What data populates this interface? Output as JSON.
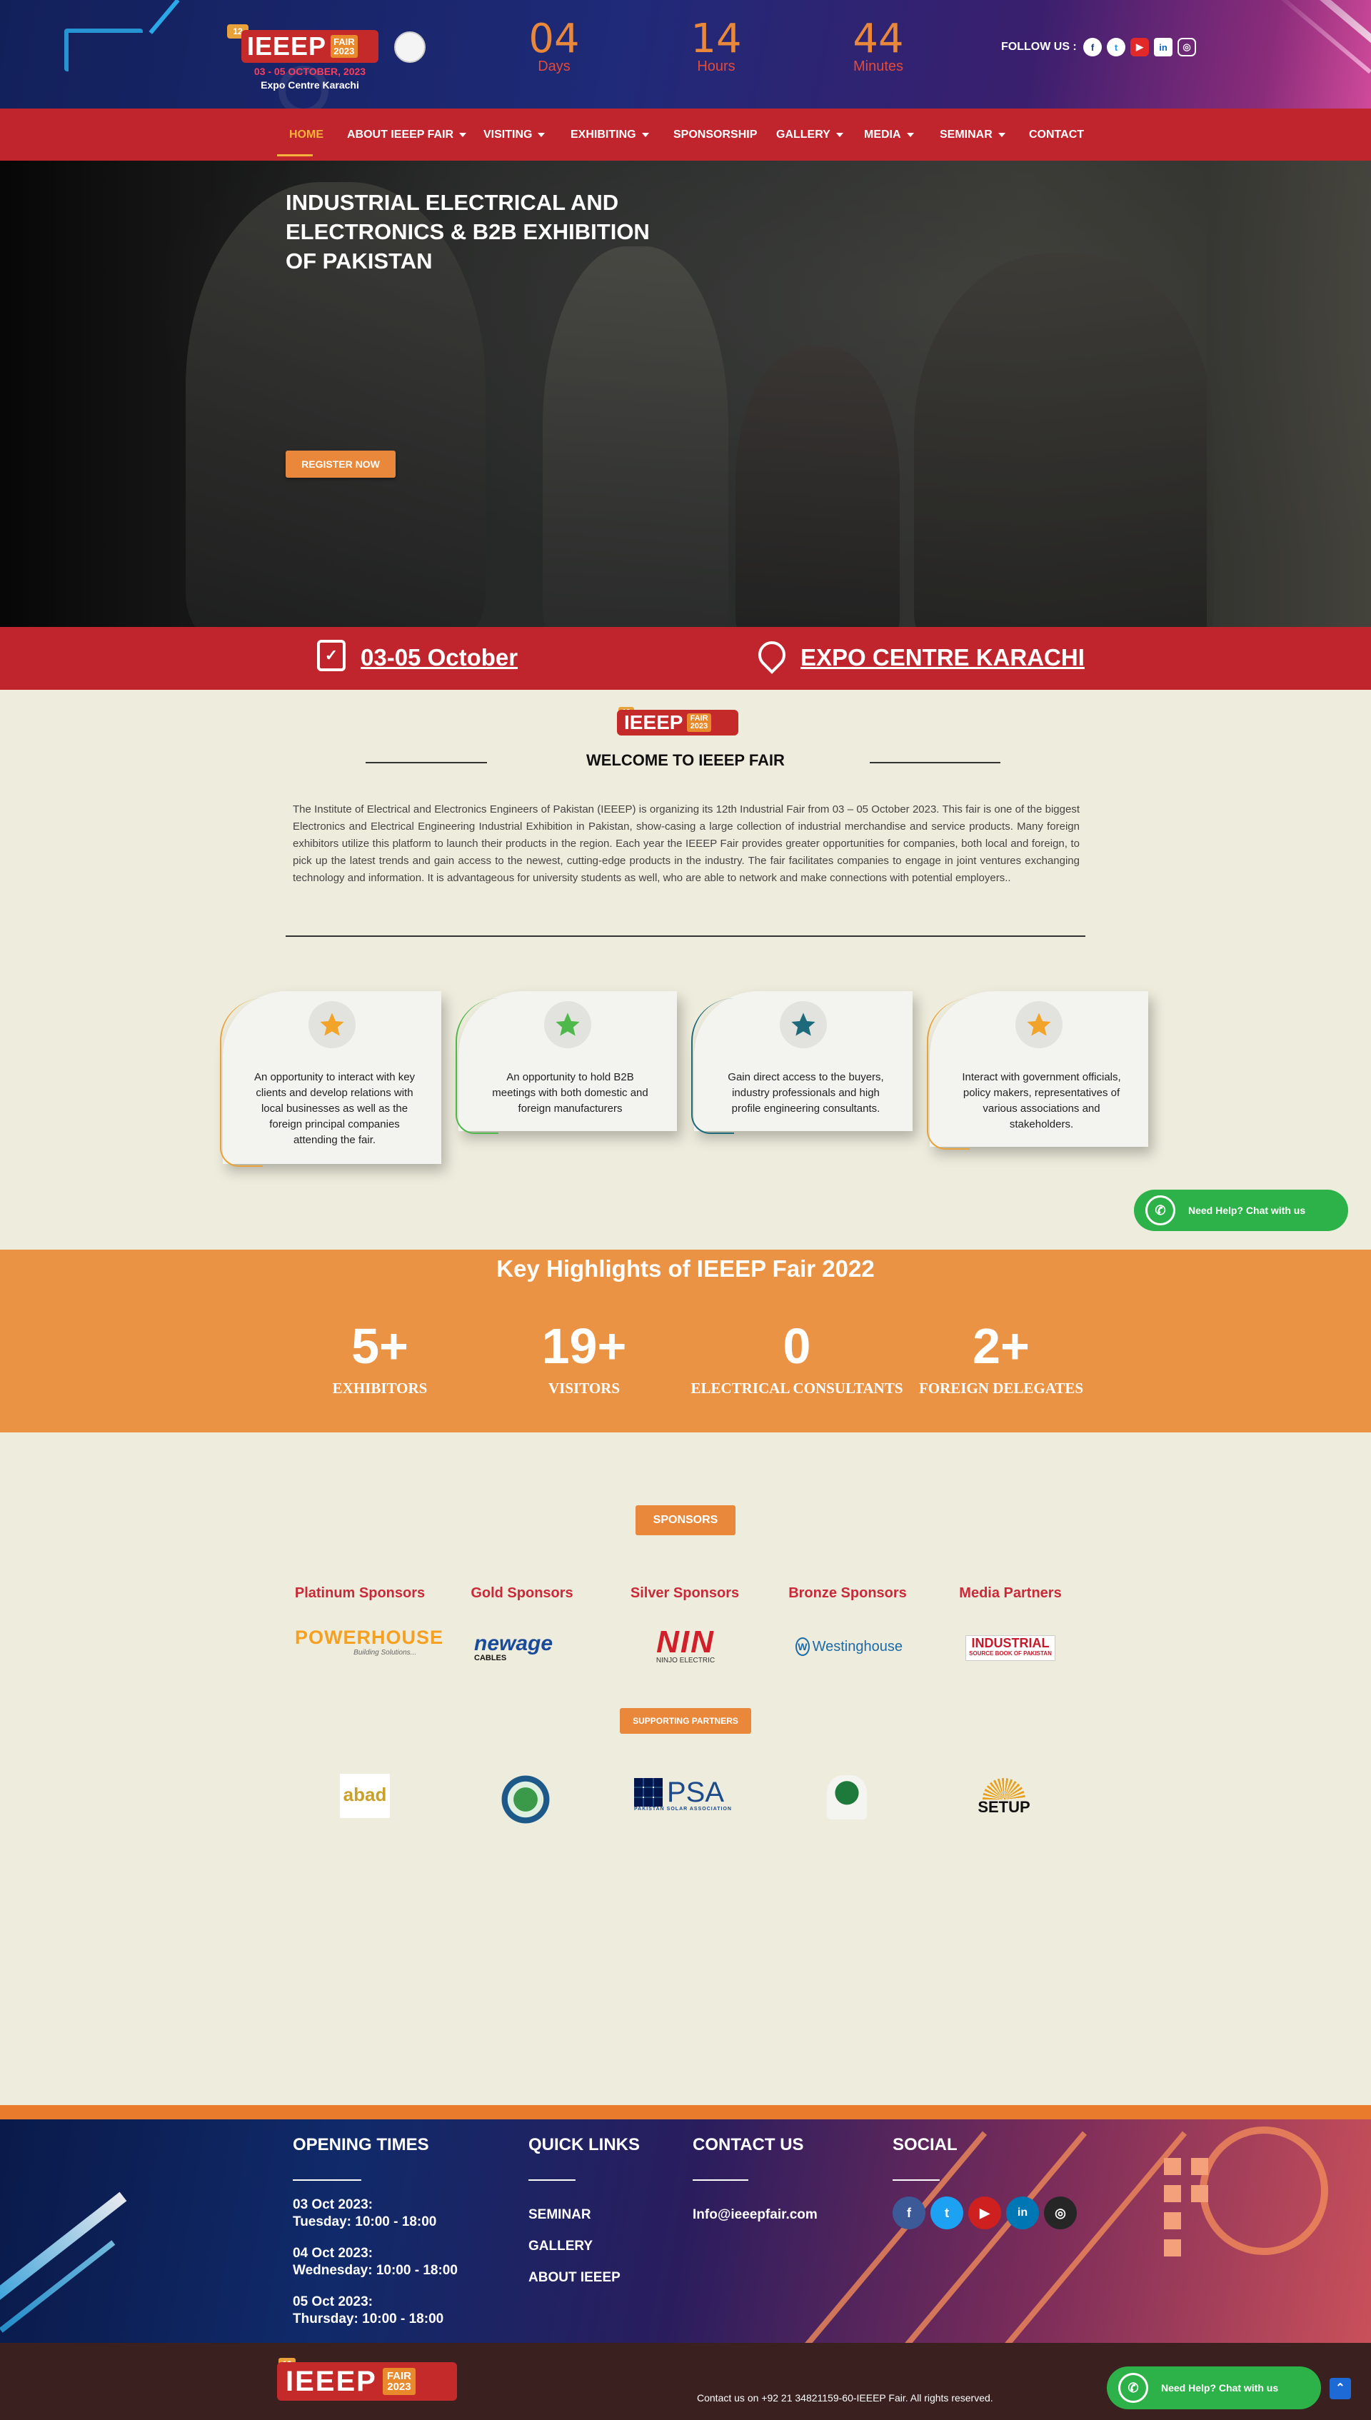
{
  "header": {
    "logo_edition": "12",
    "logo_name": "IEEEP",
    "logo_fair": "FAIR",
    "logo_year": "2023",
    "logo_dates": "03 - 05 OCTOBER, 2023",
    "logo_venue": "Expo Centre Karachi",
    "countdown": [
      {
        "value": "04",
        "label": "Days"
      },
      {
        "value": "14",
        "label": "Hours"
      },
      {
        "value": "44",
        "label": "Minutes"
      }
    ],
    "follow_label": "FOLLOW US :"
  },
  "nav": {
    "items": [
      {
        "label": "HOME",
        "active": true,
        "dropdown": false
      },
      {
        "label": "ABOUT IEEEP FAIR",
        "dropdown": true
      },
      {
        "label": "VISITING",
        "dropdown": true
      },
      {
        "label": "EXHIBITING",
        "dropdown": true
      },
      {
        "label": "SPONSORSHIP",
        "dropdown": false
      },
      {
        "label": "GALLERY",
        "dropdown": true
      },
      {
        "label": "MEDIA",
        "dropdown": true
      },
      {
        "label": "SEMINAR",
        "dropdown": true
      },
      {
        "label": "CONTACT",
        "dropdown": false
      }
    ]
  },
  "hero": {
    "title": "INDUSTRIAL ELECTRICAL AND ELECTRONICS & B2B EXHIBITION OF PAKISTAN",
    "cta": "REGISTER NOW"
  },
  "info_bar": {
    "date": "03-05 October",
    "venue": "EXPO CENTRE KARACHI"
  },
  "welcome": {
    "title": "WELCOME TO IEEEP FAIR",
    "text": "The Institute of Electrical and Electronics Engineers of Pakistan (IEEEP) is organizing its 12th Industrial Fair from 03 – 05 October 2023. This fair is one of the biggest Electronics and Electrical Engineering Industrial Exhibition in Pakistan, show-casing a large collection of industrial merchandise and service products. Many foreign exhibitors utilize this platform to launch their products in the region. Each year the IEEEP Fair provides greater opportunities for companies, both local and foreign, to pick up the latest trends and gain access to the newest, cutting-edge products in the industry. The fair facilitates companies to engage in joint ventures exchanging technology and information. It is advantageous for university students as well, who are able to network and make connections with potential employers.."
  },
  "benefits": [
    {
      "text": "An opportunity to interact with key clients and develop relations with local businesses as well as the foreign principal companies attending the fair.",
      "star_color": "#f2a32a",
      "ring_color": "#e9a13a"
    },
    {
      "text": "An opportunity to hold B2B meetings with both domestic and foreign manufacturers",
      "star_color": "#4fb84a",
      "ring_color": "#4fb84a"
    },
    {
      "text": "Gain direct access to the buyers, industry professionals and high profile engineering consultants.",
      "star_color": "#1d6a7a",
      "ring_color": "#1d6a7a"
    },
    {
      "text": "Interact with government officials, policy makers, representatives of various associations and stakeholders.",
      "star_color": "#f2a32a",
      "ring_color": "#e9a13a"
    }
  ],
  "whatsapp": {
    "label": "Need Help? Chat with us"
  },
  "highlights": {
    "title": "Key Highlights of IEEEP Fair 2022",
    "stats": [
      {
        "value": "5+",
        "label": "EXHIBITORS"
      },
      {
        "value": "19+",
        "label": "VISITORS"
      },
      {
        "value": "0",
        "label": "ELECTRICAL CONSULTANTS"
      },
      {
        "value": "2+",
        "label": "FOREIGN DELEGATES"
      }
    ]
  },
  "sponsors": {
    "button": "SPONSORS",
    "tiers": [
      {
        "tier": "Platinum Sponsors",
        "logo": "POWERHOUSE",
        "logo_sub": "Building Solutions..."
      },
      {
        "tier": "Gold Sponsors",
        "logo": "newage",
        "logo_sub": "CABLES"
      },
      {
        "tier": "Silver Sponsors",
        "logo": "NIN",
        "logo_sub": "NINJO ELECTRIC"
      },
      {
        "tier": "Bronze Sponsors",
        "logo": "Westinghouse",
        "logo_sub": ""
      },
      {
        "tier": "Media Partners",
        "logo": "INDUSTRIAL",
        "logo_sub": "SOURCE BOOK OF PAKISTAN"
      }
    ]
  },
  "partners": {
    "button": "SUPPORTING PARTNERS",
    "logos": [
      {
        "name": "abad"
      },
      {
        "name": "seal"
      },
      {
        "name": "PSA",
        "sub": "PAKISTAN SOLAR ASSOCIATION"
      },
      {
        "name": "emblem"
      },
      {
        "name": "SETUP"
      }
    ]
  },
  "footer": {
    "opening": {
      "title": "OPENING TIMES",
      "days": [
        {
          "date": "03 Oct 2023:",
          "time": "Tuesday: 10:00 - 18:00"
        },
        {
          "date": "04 Oct 2023:",
          "time": "Wednesday: 10:00 - 18:00"
        },
        {
          "date": "05 Oct 2023:",
          "time": "Thursday: 10:00 - 18:00"
        }
      ]
    },
    "quick_links": {
      "title": "QUICK LINKS",
      "links": [
        "SEMINAR",
        "GALLERY",
        "ABOUT IEEEP"
      ]
    },
    "contact": {
      "title": "CONTACT US",
      "email": "Info@ieeepfair.com"
    },
    "social": {
      "title": "SOCIAL"
    },
    "copyright": "Contact us on +92 21 34821159-60-IEEEP Fair. All rights reserved."
  },
  "colors": {
    "brand_red": "#c0242c",
    "brand_orange": "#e9883a",
    "whatsapp_green": "#2db24a",
    "page_bg": "#eeecdc"
  }
}
